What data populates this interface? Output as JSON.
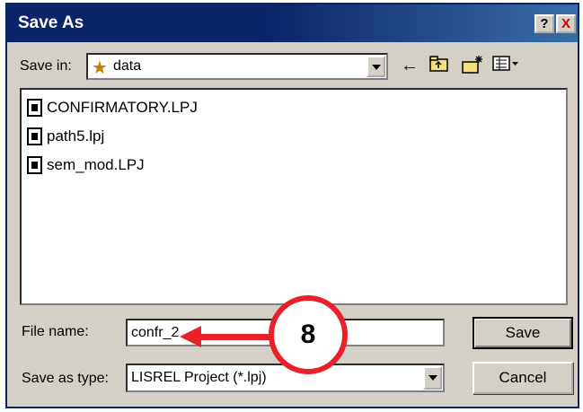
{
  "window": {
    "title": "Save As",
    "help_label": "?",
    "close_label": "X"
  },
  "save_in": {
    "label": "Save in:",
    "folder": "data",
    "folder_icon": "star-folder-icon"
  },
  "toolbar": {
    "back_icon": "←",
    "up_icon": "up-folder-icon",
    "new_folder_icon": "new-folder-icon",
    "views_icon": "views-menu-icon"
  },
  "files": [
    {
      "name": "CONFIRMATORY.LPJ"
    },
    {
      "name": "path5.lpj"
    },
    {
      "name": "sem_mod.LPJ"
    }
  ],
  "file_name": {
    "label": "File name:",
    "value": "confr_2"
  },
  "save_as_type": {
    "label": "Save as type:",
    "value": "LISREL Project (*.lpj)"
  },
  "buttons": {
    "save": "Save",
    "cancel": "Cancel"
  },
  "annotation": {
    "step_number": "8",
    "color": "#e8202a"
  }
}
